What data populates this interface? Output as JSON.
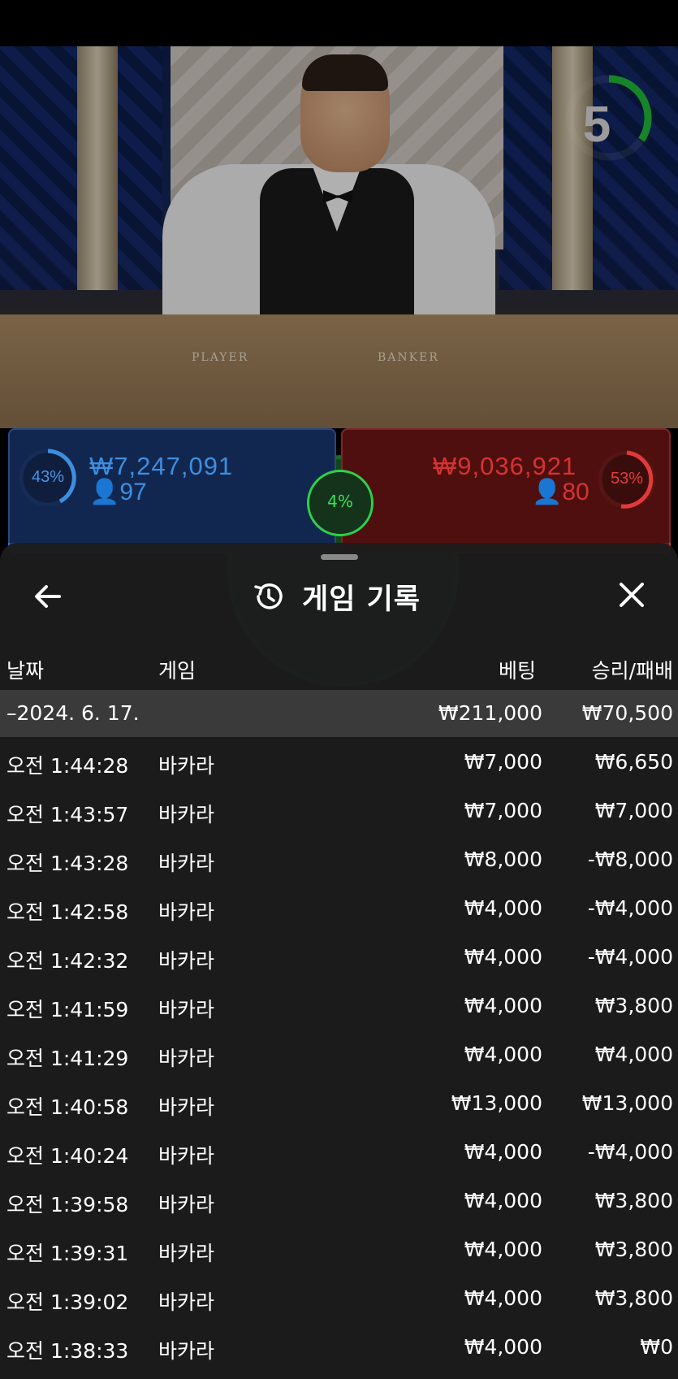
{
  "timer": {
    "value": "5"
  },
  "table": {
    "player_label": "PLAYER",
    "banker_label": "BANKER"
  },
  "bets": {
    "player": {
      "percent": "43%",
      "amount": "₩7,247,091",
      "players": "97",
      "color": "#3e8ee0"
    },
    "banker": {
      "percent": "53%",
      "amount": "₩9,036,921",
      "players": "80",
      "color": "#e23a3a"
    },
    "tie": {
      "percent": "4%",
      "color": "#3ce05a"
    }
  },
  "panel": {
    "title": "게임 기록",
    "columns": {
      "date": "날짜",
      "game": "게임",
      "bet": "베팅",
      "result": "승리/패배"
    },
    "date_group": {
      "date": "–2024. 6. 17.",
      "bet_total": "₩211,000",
      "result_total": "₩70,500"
    },
    "rows": [
      {
        "time": "오전 1:44:28",
        "game": "바카라",
        "bet": "₩7,000",
        "result": "₩6,650"
      },
      {
        "time": "오전 1:43:57",
        "game": "바카라",
        "bet": "₩7,000",
        "result": "₩7,000"
      },
      {
        "time": "오전 1:43:28",
        "game": "바카라",
        "bet": "₩8,000",
        "result": "-₩8,000"
      },
      {
        "time": "오전 1:42:58",
        "game": "바카라",
        "bet": "₩4,000",
        "result": "-₩4,000"
      },
      {
        "time": "오전 1:42:32",
        "game": "바카라",
        "bet": "₩4,000",
        "result": "-₩4,000"
      },
      {
        "time": "오전 1:41:59",
        "game": "바카라",
        "bet": "₩4,000",
        "result": "₩3,800"
      },
      {
        "time": "오전 1:41:29",
        "game": "바카라",
        "bet": "₩4,000",
        "result": "₩4,000"
      },
      {
        "time": "오전 1:40:58",
        "game": "바카라",
        "bet": "₩13,000",
        "result": "₩13,000"
      },
      {
        "time": "오전 1:40:24",
        "game": "바카라",
        "bet": "₩4,000",
        "result": "-₩4,000"
      },
      {
        "time": "오전 1:39:58",
        "game": "바카라",
        "bet": "₩4,000",
        "result": "₩3,800"
      },
      {
        "time": "오전 1:39:31",
        "game": "바카라",
        "bet": "₩4,000",
        "result": "₩3,800"
      },
      {
        "time": "오전 1:39:02",
        "game": "바카라",
        "bet": "₩4,000",
        "result": "₩3,800"
      },
      {
        "time": "오전 1:38:33",
        "game": "바카라",
        "bet": "₩4,000",
        "result": "₩0"
      }
    ]
  }
}
